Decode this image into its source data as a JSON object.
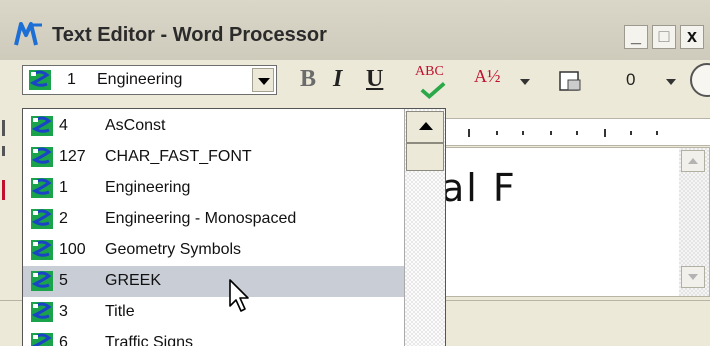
{
  "window": {
    "title": "Text Editor - Word Processor",
    "controls": {
      "minimize": "_",
      "maximize": "□",
      "close": "x"
    }
  },
  "toolbar": {
    "font_combo": {
      "number": "1",
      "name": "Engineering"
    },
    "bold_label": "B",
    "italic_label": "I",
    "underline_label": "U",
    "spell_label": "ABC",
    "fraction_label": "A½",
    "number_label": "0"
  },
  "editor": {
    "visible_text": "al F"
  },
  "font_list": {
    "selected_index": 5,
    "items": [
      {
        "number": "4",
        "name": "AsConst"
      },
      {
        "number": "127",
        "name": "CHAR_FAST_FONT"
      },
      {
        "number": "1",
        "name": "Engineering"
      },
      {
        "number": "2",
        "name": "Engineering - Monospaced"
      },
      {
        "number": "100",
        "name": "Geometry Symbols"
      },
      {
        "number": "5",
        "name": "GREEK"
      },
      {
        "number": "3",
        "name": "Title"
      },
      {
        "number": "6",
        "name": "Traffic Signs"
      }
    ]
  },
  "colors": {
    "selected_row": "#c9cdd6",
    "icon_green": "#1aa34a",
    "icon_blue": "#1b43c8",
    "window_face": "#ece9d8"
  }
}
